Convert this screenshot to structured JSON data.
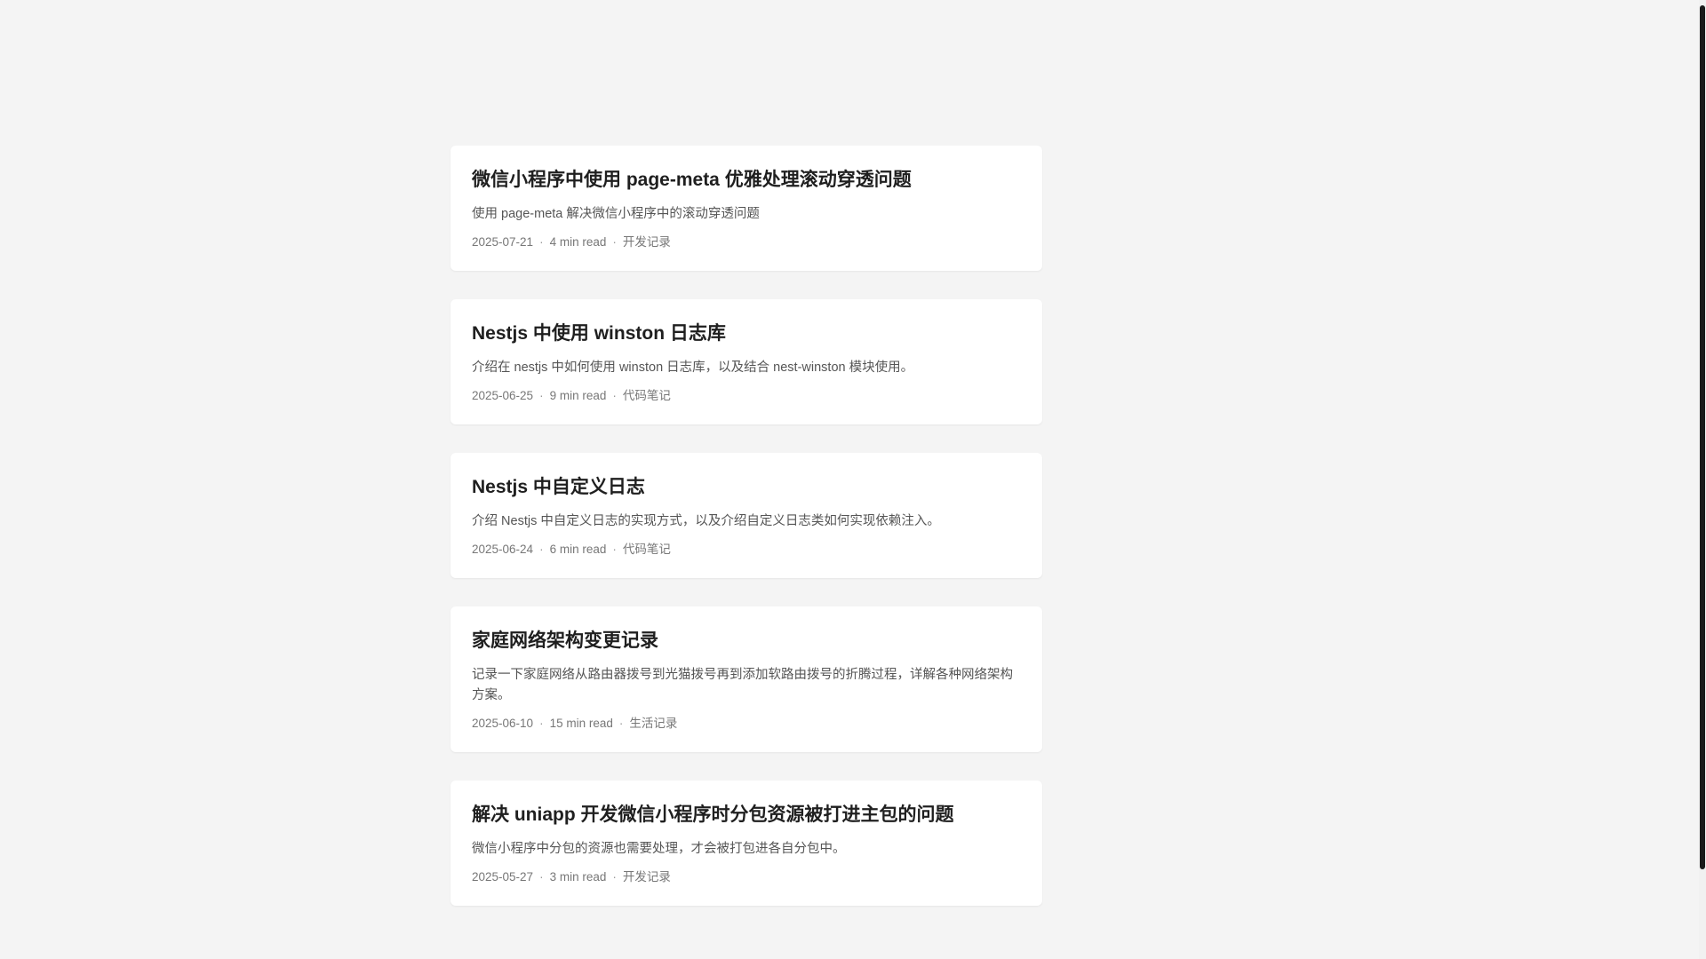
{
  "posts": [
    {
      "title": "微信小程序中使用 page-meta 优雅处理滚动穿透问题",
      "description": "使用 page-meta 解决微信小程序中的滚动穿透问题",
      "date": "2025-07-21",
      "read_time": "4 min read",
      "category": "开发记录"
    },
    {
      "title": "Nestjs 中使用 winston 日志库",
      "description": "介绍在 nestjs 中如何使用 winston 日志库，以及结合 nest-winston 模块使用。",
      "date": "2025-06-25",
      "read_time": "9 min read",
      "category": "代码笔记"
    },
    {
      "title": "Nestjs 中自定义日志",
      "description": "介绍 Nestjs 中自定义日志的实现方式，以及介绍自定义日志类如何实现依赖注入。",
      "date": "2025-06-24",
      "read_time": "6 min read",
      "category": "代码笔记"
    },
    {
      "title": "家庭网络架构变更记录",
      "description": "记录一下家庭网络从路由器拨号到光猫拨号再到添加软路由拨号的折腾过程，详解各种网络架构方案。",
      "date": "2025-06-10",
      "read_time": "15 min read",
      "category": "生活记录"
    },
    {
      "title": "解决 uniapp 开发微信小程序时分包资源被打进主包的问题",
      "description": "微信小程序中分包的资源也需要处理，才会被打包进各自分包中。",
      "date": "2025-05-27",
      "read_time": "3 min read",
      "category": "开发记录"
    }
  ],
  "meta_separator": "·",
  "colors": {
    "background": "#f4f4f4",
    "card": "#ffffff",
    "title": "#1f1f1f",
    "description": "#555555",
    "meta": "#777777"
  }
}
